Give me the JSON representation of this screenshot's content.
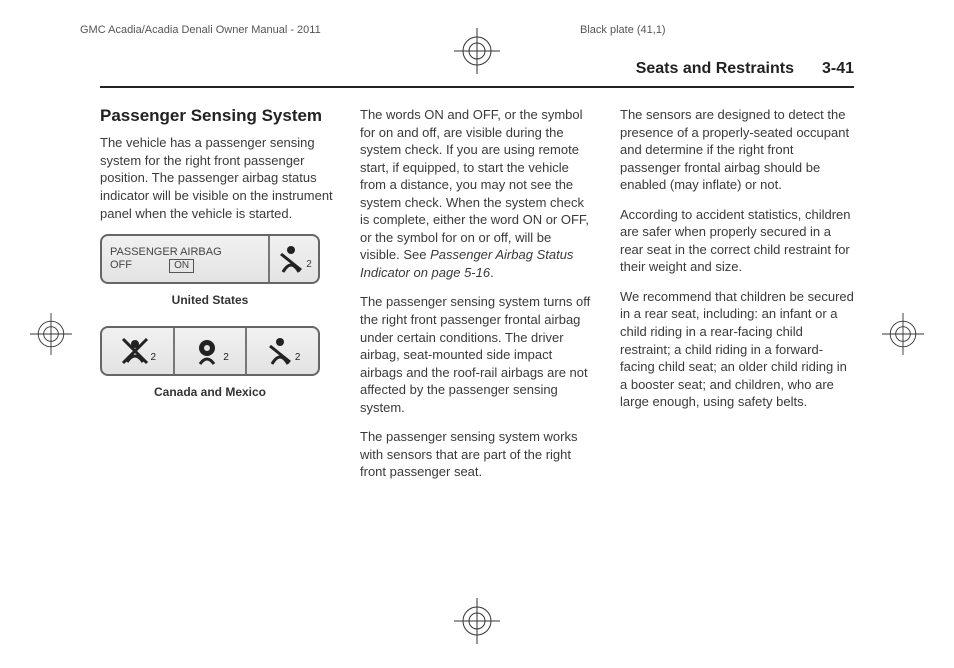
{
  "print": {
    "manual": "GMC Acadia/Acadia Denali Owner Manual - 2011",
    "plate": "Black plate (41,1)"
  },
  "header": {
    "section": "Seats and Restraints",
    "page": "3-41"
  },
  "col1": {
    "heading": "Passenger Sensing System",
    "p1": "The vehicle has a passenger sensing system for the right front passenger position. The passenger airbag status indicator will be visible on the instrument panel when the vehicle is started.",
    "fig_us": {
      "line1": "PASSENGER AIRBAG",
      "line2": "OFF",
      "on_box": "ON",
      "caption": "United States"
    },
    "fig_cm": {
      "caption": "Canada and Mexico"
    }
  },
  "col2": {
    "p1": "The words ON and OFF, or the symbol for on and off, are visible during the system check. If you are using remote start, if equipped, to start the vehicle from a distance, you may not see the system check. When the system check is complete, either the word ON or OFF, or the symbol for on or off, will be visible. See ",
    "p1_ref": "Passenger Airbag Status Indicator on page 5‑16",
    "p1_tail": ".",
    "p2": "The passenger sensing system turns off the right front passenger frontal airbag under certain conditions. The driver airbag, seat-mounted side impact airbags and the roof-rail airbags are not affected by the passenger sensing system.",
    "p3": "The passenger sensing system works with sensors that are part of the right front passenger seat."
  },
  "col3": {
    "p1": "The sensors are designed to detect the presence of a properly-seated occupant and determine if the right front passenger frontal airbag should be enabled (may inflate) or not.",
    "p2": "According to accident statistics, children are safer when properly secured in a rear seat in the correct child restraint for their weight and size.",
    "p3": "We recommend that children be secured in a rear seat, including: an infant or a child riding in a rear-facing child restraint; a child riding in a forward-facing child seat; an older child riding in a booster seat; and children, who are large enough, using safety belts."
  }
}
